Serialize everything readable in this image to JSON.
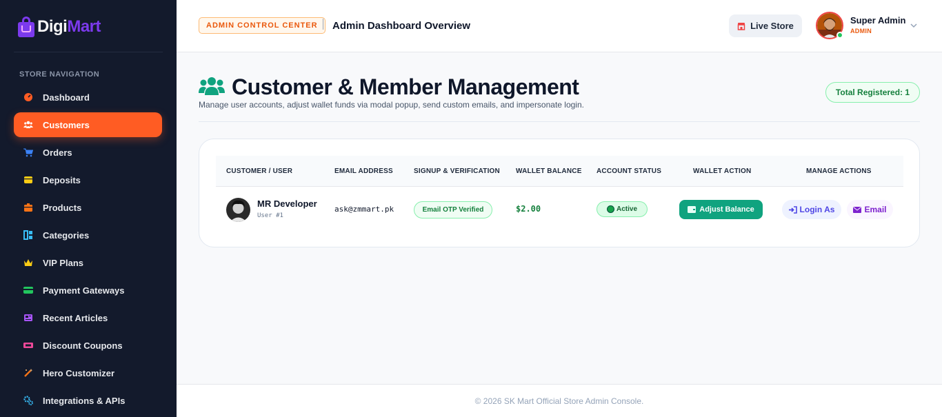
{
  "brand": {
    "name_part1": "Digi",
    "name_part2": "Mart",
    "accent": "#7c3aed"
  },
  "sidebar": {
    "heading": "STORE NAVIGATION",
    "items": [
      {
        "label": "Dashboard",
        "icon": "dashboard-gauge-icon",
        "color": "#ff5c23",
        "active": false
      },
      {
        "label": "Customers",
        "icon": "users-icon",
        "color": "#ffffff",
        "active": true
      },
      {
        "label": "Orders",
        "icon": "cart-icon",
        "color": "#3b82f6",
        "active": false
      },
      {
        "label": "Deposits",
        "icon": "wallet-icon",
        "color": "#facc15",
        "active": false
      },
      {
        "label": "Products",
        "icon": "box-icon",
        "color": "#f97316",
        "active": false
      },
      {
        "label": "Categories",
        "icon": "sitemap-icon",
        "color": "#38bdf8",
        "active": false
      },
      {
        "label": "VIP Plans",
        "icon": "crown-icon",
        "color": "#facc15",
        "active": false
      },
      {
        "label": "Payment Gateways",
        "icon": "credit-card-icon",
        "color": "#22c55e",
        "active": false
      },
      {
        "label": "Recent Articles",
        "icon": "newspaper-icon",
        "color": "#a855f7",
        "active": false
      },
      {
        "label": "Discount Coupons",
        "icon": "ticket-icon",
        "color": "#ec4899",
        "active": false
      },
      {
        "label": "Hero Customizer",
        "icon": "magic-wand-icon",
        "color": "#f97316",
        "active": false
      },
      {
        "label": "Integrations & APIs",
        "icon": "cogs-icon",
        "color": "#38bdf8",
        "active": false
      }
    ]
  },
  "header": {
    "badge": "ADMIN CONTROL CENTER",
    "title": "Admin Dashboard Overview",
    "live_store": "Live Store",
    "user_name": "Super Admin",
    "user_role": "ADMIN"
  },
  "main": {
    "title": "Customer & Member Management",
    "subtitle": "Manage user accounts, adjust wallet funds via modal popup, send custom emails, and impersonate login.",
    "total_registered": "Total Registered: 1",
    "table": {
      "headers": [
        "CUSTOMER / USER",
        "EMAIL ADDRESS",
        "SIGNUP & VERIFICATION",
        "WALLET BALANCE",
        "ACCOUNT STATUS",
        "WALLET ACTION",
        "MANAGE ACTIONS"
      ],
      "rows": [
        {
          "name": "MR Developer",
          "user_id": "User #1",
          "email": "ask@zmmart.pk",
          "verification": "Email OTP Verified",
          "balance": "$2.00",
          "status": "Active",
          "wallet_action": "Adjust Balance",
          "login_as": "Login As",
          "email_action": "Email"
        }
      ]
    }
  },
  "footer": {
    "text": "© 2026 SK Mart Official Store Admin Console."
  }
}
